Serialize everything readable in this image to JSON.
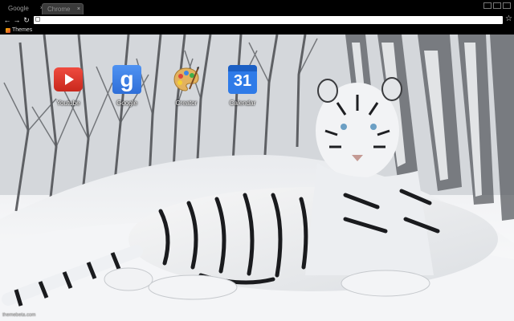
{
  "tabs": [
    {
      "label": "Google",
      "close": "×"
    },
    {
      "label": "Chrome",
      "close": "×"
    }
  ],
  "toolbar": {
    "back": "←",
    "forward": "→",
    "reload": "↻",
    "star": "☆",
    "omnibox_value": ""
  },
  "bookmarks": [
    {
      "label": "Themes",
      "icon": "themes-icon"
    }
  ],
  "apps": [
    {
      "label": "Youtube",
      "icon": "youtube-icon",
      "color": "#e53a2f"
    },
    {
      "label": "Google",
      "icon": "google-search-icon",
      "glyph": "g",
      "color": "#3b82ee"
    },
    {
      "label": "Creator",
      "icon": "palette-icon",
      "color": "#e0a84a"
    },
    {
      "label": "Calendar",
      "icon": "calendar-icon",
      "glyph": "31",
      "color": "#2f7be8"
    }
  ],
  "watermark": "themebeta.com"
}
